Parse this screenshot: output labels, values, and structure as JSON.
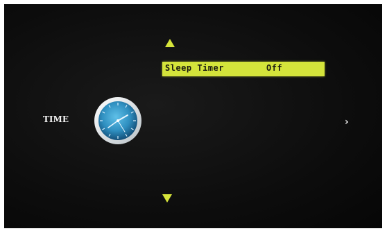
{
  "menu": {
    "category": "TIME",
    "selected_item": {
      "label": "Sleep Timer",
      "value": "Off"
    }
  },
  "icons": {
    "category_icon": "clock-icon",
    "scroll_up": "triangle-up-icon",
    "scroll_down": "triangle-down-icon",
    "next": "chevron-right-icon"
  },
  "colors": {
    "highlight": "#d4e43b",
    "arrow": "#d6e43a",
    "background": "#0d0d0d",
    "text": "#f0f0f0",
    "clock_face": "#2f8fc0"
  }
}
